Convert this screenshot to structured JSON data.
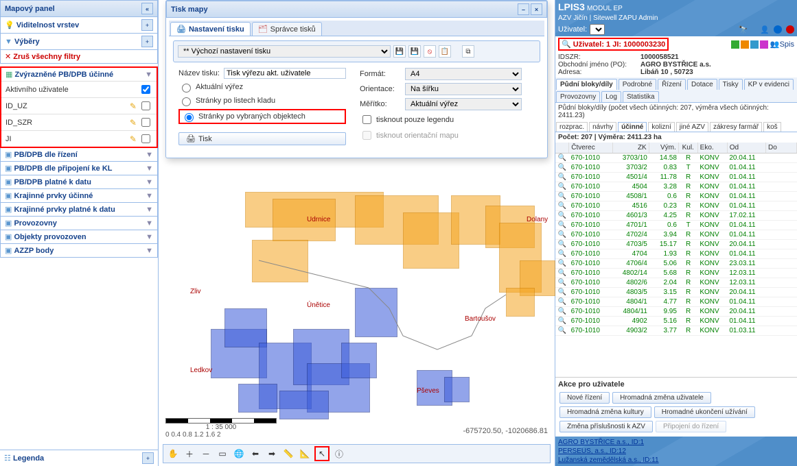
{
  "left_panel": {
    "title": "Mapový panel",
    "sections": {
      "visibility": "Viditelnost vrstev",
      "selections": "Výběry",
      "clear_filters": "Zruš všechny filtry",
      "highlighted": "Zvýrazněné PB/DPB účinné",
      "by_process": "PB/DPB dle řízení",
      "by_connection": "PB/DPB dle připojení ke KL",
      "valid_date": "PB/DPB platné k datu",
      "landscape_valid": "Krajinné prvky účinné",
      "landscape_date": "Krajinné prvky platné k datu",
      "branches": "Provozovny",
      "branch_objects": "Objekty provozoven",
      "azzp": "AZZP body"
    },
    "highlight_rows": [
      "Aktivního uživatele",
      "ID_UZ",
      "ID_SZR",
      "JI"
    ],
    "legend": "Legenda"
  },
  "print_dialog": {
    "title": "Tisk mapy",
    "tab_settings": "Nastavení tisku",
    "tab_manager": "Správce tisků",
    "preset": "** Výchozí nastavení tisku",
    "name_label": "Název tisku:",
    "name_value": "Tisk výřezu akt. uživatele",
    "format_label": "Formát:",
    "format_value": "A4",
    "orientation_label": "Orientace:",
    "orientation_value": "Na šířku",
    "scale_label": "Měřítko:",
    "scale_value": "Aktuální výřez",
    "radio_current": "Aktuální výřez",
    "radio_sheets": "Stránky po listech kladu",
    "radio_objects": "Stránky po vybraných objektech",
    "chk_legend": "tisknout pouze legendu",
    "chk_orient": "tisknout orientační mapu",
    "btn_print": "Tisk"
  },
  "map": {
    "towns": {
      "udrnice": "Udrnice",
      "dolany": "Dolany",
      "zliv": "Zliv",
      "unetice": "Únětice",
      "bartousov": "Bartoušov",
      "ledkov": "Ledkov",
      "psev": "Pševes"
    },
    "scale_label": "1 : 35 000",
    "scale_ticks": "0    0.4    0.8    1.2    1.6    2",
    "coords": "-675720.50, -1020686.81"
  },
  "right": {
    "app_title": "LPIS3",
    "module": "MODUL EP",
    "subtitle": "AZV Jičín | Sitewell ZAPU Admin",
    "user_label": "Uživatel:",
    "user_line": "Uživatel: 1 JI: 1000003230",
    "idszr_k": "IDSZR:",
    "idszr_v": "1000058521",
    "name_k": "Obchodní jméno (PO):",
    "name_v": "AGRO BYSTŘICE a.s.",
    "addr_k": "Adresa:",
    "addr_v": "Libáň 10 , 50723",
    "spis": "Spis",
    "tabs": [
      "Půdní bloky/díly",
      "Podrobné",
      "Řízení",
      "Dotace",
      "Tisky",
      "KP v evidenci",
      "Provozovny",
      "Log",
      "Statistika"
    ],
    "summary": "Půdní bloky/díly (počet všech účinných: 207, výměra všech účinných: 2411.23)",
    "subtabs": [
      "rozprac.",
      "návrhy",
      "účinné",
      "kolizní",
      "jiné AZV",
      "zákresy farmář",
      "koš"
    ],
    "count_line": "Počet: 207 | Výměra: 2411.23 ha",
    "cols": [
      "",
      "Čtverec",
      "ZK",
      "Vým.",
      "Kul.",
      "Eko.",
      "Od",
      "Do"
    ],
    "rows": [
      [
        "670-1010",
        "3703/10",
        "14.58",
        "R",
        "KONV",
        "20.04.11",
        ""
      ],
      [
        "670-1010",
        "3703/2",
        "0.83",
        "T",
        "KONV",
        "01.04.11",
        ""
      ],
      [
        "670-1010",
        "4501/4",
        "11.78",
        "R",
        "KONV",
        "01.04.11",
        ""
      ],
      [
        "670-1010",
        "4504",
        "3.28",
        "R",
        "KONV",
        "01.04.11",
        ""
      ],
      [
        "670-1010",
        "4508/1",
        "0.6",
        "R",
        "KONV",
        "01.04.11",
        ""
      ],
      [
        "670-1010",
        "4516",
        "0.23",
        "R",
        "KONV",
        "01.04.11",
        ""
      ],
      [
        "670-1010",
        "4601/3",
        "4.25",
        "R",
        "KONV",
        "17.02.11",
        ""
      ],
      [
        "670-1010",
        "4701/1",
        "0.6",
        "T",
        "KONV",
        "01.04.11",
        ""
      ],
      [
        "670-1010",
        "4702/4",
        "3.94",
        "R",
        "KONV",
        "01.04.11",
        ""
      ],
      [
        "670-1010",
        "4703/5",
        "15.17",
        "R",
        "KONV",
        "20.04.11",
        ""
      ],
      [
        "670-1010",
        "4704",
        "1.93",
        "R",
        "KONV",
        "01.04.11",
        ""
      ],
      [
        "670-1010",
        "4706/4",
        "5.06",
        "R",
        "KONV",
        "23.03.11",
        ""
      ],
      [
        "670-1010",
        "4802/14",
        "5.68",
        "R",
        "KONV",
        "12.03.11",
        ""
      ],
      [
        "670-1010",
        "4802/6",
        "2.04",
        "R",
        "KONV",
        "12.03.11",
        ""
      ],
      [
        "670-1010",
        "4803/5",
        "3.15",
        "R",
        "KONV",
        "20.04.11",
        ""
      ],
      [
        "670-1010",
        "4804/1",
        "4.77",
        "R",
        "KONV",
        "01.04.11",
        ""
      ],
      [
        "670-1010",
        "4804/11",
        "9.95",
        "R",
        "KONV",
        "20.04.11",
        ""
      ],
      [
        "670-1010",
        "4902",
        "5.16",
        "R",
        "KONV",
        "01.04.11",
        ""
      ],
      [
        "670-1010",
        "4903/2",
        "3.77",
        "R",
        "KONV",
        "01.03.11",
        ""
      ]
    ],
    "actions_title": "Akce pro uživatele",
    "btns": [
      "Nové řízení",
      "Hromadná změna uživatele",
      "Hromadná změna kultury",
      "Hromadné ukončení užívání",
      "Změna příslušnosti k AZV",
      "Připojení do řízení"
    ],
    "footer": [
      "AGRO BYSTŘICE a.s., ID:1",
      "PERSEUS, a.s., ID:12",
      "Lužanská zemědělská a.s., ID:11"
    ]
  }
}
